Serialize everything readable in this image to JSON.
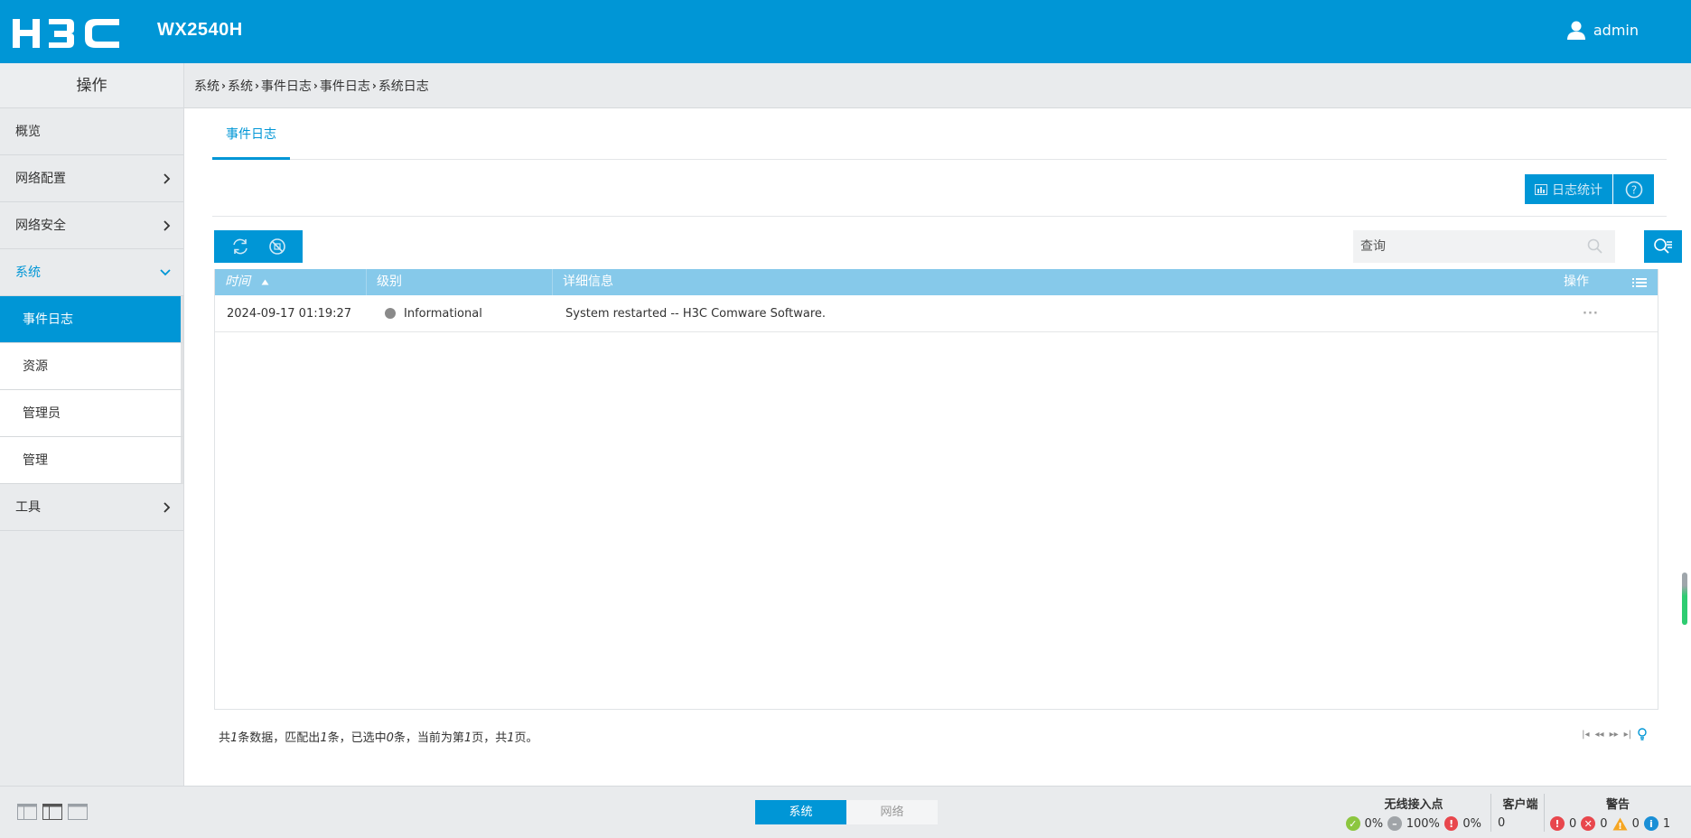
{
  "header": {
    "model": "WX2540H",
    "user": "admin"
  },
  "sidebar": {
    "title": "操作",
    "items": [
      {
        "label": "概览"
      },
      {
        "label": "网络配置"
      },
      {
        "label": "网络安全"
      },
      {
        "label": "系统"
      },
      {
        "label": "工具"
      }
    ],
    "sub_items": [
      {
        "label": "事件日志"
      },
      {
        "label": "资源"
      },
      {
        "label": "管理员"
      },
      {
        "label": "管理"
      }
    ]
  },
  "breadcrumb": [
    "系统",
    "系统",
    "事件日志",
    "事件日志",
    "系统日志"
  ],
  "tabs": [
    {
      "label": "事件日志"
    }
  ],
  "toolbar": {
    "stats_label": "日志统计"
  },
  "search": {
    "placeholder": "查询"
  },
  "table": {
    "columns": {
      "time": "时间",
      "level": "级别",
      "detail": "详细信息",
      "ops": "操作"
    },
    "rows": [
      {
        "time": "2024-09-17 01:19:27",
        "level": "Informational",
        "detail": "System restarted -- H3C Comware Software.",
        "ops": "···"
      }
    ]
  },
  "footer": {
    "prefix": "共",
    "total": "1",
    "t1": "条数据，匹配出",
    "matched": "1",
    "t2": "条，已选中",
    "selected": "0",
    "t3": "条，当前为第",
    "page": "1",
    "t4": "页，共",
    "pages": "1",
    "t5": "页。"
  },
  "statusbar": {
    "switch_on": "系统",
    "switch_off": "网络",
    "ap": {
      "title": "无线接入点",
      "online": "0%",
      "offline": "100%",
      "fault": "0%"
    },
    "clients": {
      "title": "客户端",
      "value": "0"
    },
    "alerts": {
      "title": "警告",
      "critical": "0",
      "error": "0",
      "warning": "0",
      "info": "1"
    }
  },
  "colors": {
    "brand": "#0096d6",
    "table_header": "#86c9ea",
    "sidebar_bg": "#e9ebed"
  }
}
